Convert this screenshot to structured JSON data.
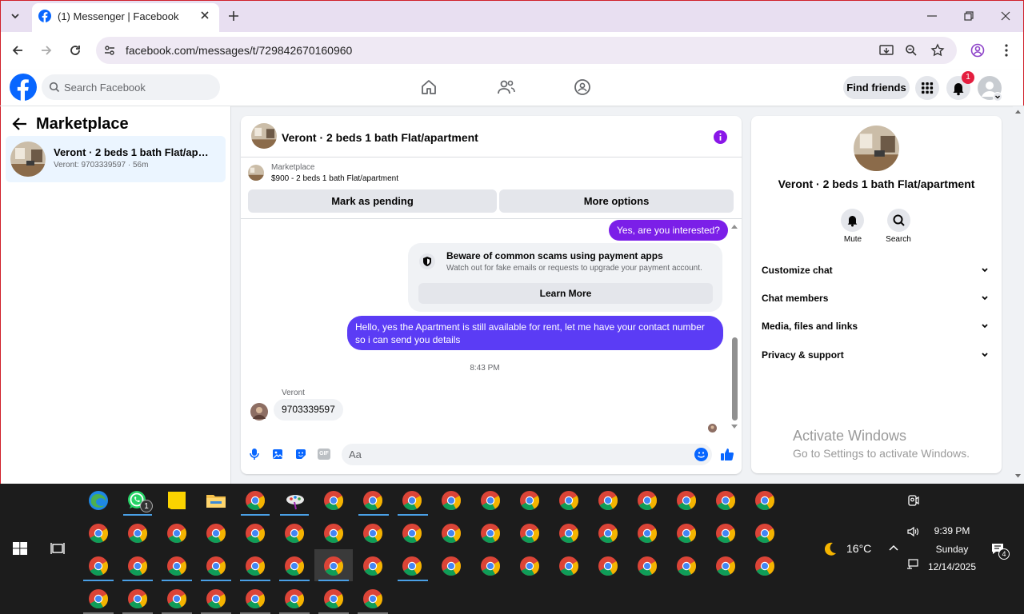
{
  "browser": {
    "tab_title": "(1) Messenger | Facebook",
    "url": "facebook.com/messages/t/729842670160960"
  },
  "fb": {
    "search_placeholder": "Search Facebook",
    "find_friends": "Find friends",
    "notification_count": "1",
    "brand_color": "#0866ff"
  },
  "sidebar": {
    "title": "Marketplace",
    "conversation": {
      "name": "Veront · 2 beds 1 bath Flat/apartment",
      "subtitle": "Veront: 9703339597 · 56m"
    }
  },
  "chat": {
    "title": "Veront · 2 beds 1 bath Flat/apartment",
    "marketplace_label": "Marketplace",
    "listing": "$900 - 2 beds 1 bath Flat/apartment",
    "mark_pending": "Mark as pending",
    "more_options": "More options",
    "messages": [
      {
        "from": "me",
        "text": "Yes, are you interested?"
      },
      {
        "from": "me",
        "text": "Hello, yes the Apartment is still available for rent, let me have your contact number so i can send you details"
      },
      {
        "from": "Veront",
        "text": "9703339597"
      }
    ],
    "warning": {
      "title": "Beware of common scams using payment apps",
      "body": "Watch out for fake emails or requests to upgrade your payment account.",
      "button": "Learn More"
    },
    "time_divider": "8:43 PM",
    "sender_name": "Veront",
    "composer_placeholder": "Aa",
    "gif_label": "GIF",
    "accent_color": "#7b1fe8"
  },
  "details": {
    "title": "Veront · 2 beds 1 bath Flat/apartment",
    "mute": "Mute",
    "search": "Search",
    "sections": [
      "Customize chat",
      "Chat members",
      "Media, files and links",
      "Privacy & support"
    ]
  },
  "watermark": {
    "line1": "Activate Windows",
    "line2": "Go to Settings to activate Windows."
  },
  "taskbar": {
    "whatsapp_badge": "1",
    "temperature": "16°C",
    "time": "9:39 PM",
    "day": "Sunday",
    "date": "12/14/2025",
    "notification_count": "4"
  }
}
